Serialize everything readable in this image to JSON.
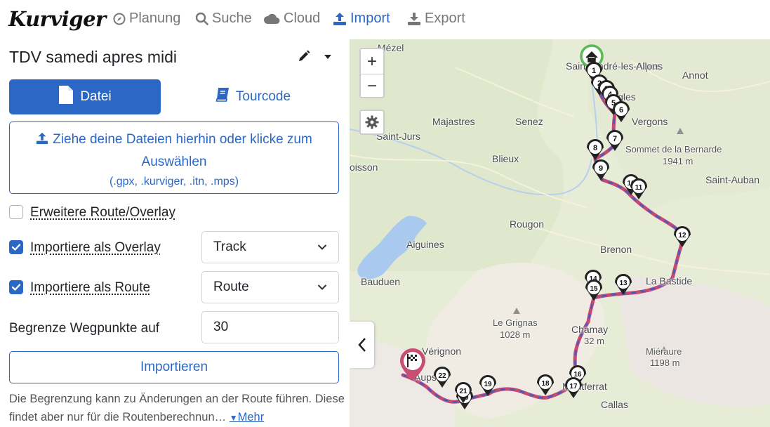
{
  "brand": {
    "logo_text": "Kurviger"
  },
  "nav": {
    "items": [
      {
        "label": "Planung",
        "icon": "compass-icon"
      },
      {
        "label": "Suche",
        "icon": "search-icon"
      },
      {
        "label": "Cloud",
        "icon": "cloud-icon"
      },
      {
        "label": "Import",
        "icon": "upload-icon",
        "active": true
      },
      {
        "label": "Export",
        "icon": "download-icon"
      }
    ]
  },
  "sidebar": {
    "route_title": "TDV samedi apres midi",
    "tabs": {
      "file_label": "Datei",
      "tourcode_label": "Tourcode"
    },
    "dropzone": {
      "main_text": "Ziehe deine Dateien hierhin oder klicke zum Auswählen",
      "formats": "(.gpx, .kurviger, .itn, .mps)"
    },
    "options": {
      "extended_route_label": "Erweitere Route/Overlay",
      "extended_route_checked": false,
      "import_overlay_label": "Importiere als Overlay",
      "import_overlay_checked": true,
      "overlay_select_value": "Track",
      "import_route_label": "Importiere als Route",
      "import_route_checked": true,
      "route_select_value": "Route",
      "limit_label": "Begrenze Wegpunkte auf",
      "limit_value": "30"
    },
    "import_button_label": "Importieren",
    "note_text": "Die Begrenzung kann zu Änderungen an der Route führen. Diese findet aber nur für die Routenberechnun…",
    "more_label": "Mehr"
  },
  "map": {
    "zoom_in_label": "+",
    "zoom_out_label": "−",
    "places": [
      {
        "name": "Mézel"
      },
      {
        "name": "Saint-André-les-Alpes"
      },
      {
        "name": "Allons"
      },
      {
        "name": "Annot"
      },
      {
        "name": "Angles"
      },
      {
        "name": "Majastres"
      },
      {
        "name": "Senez"
      },
      {
        "name": "Vergons"
      },
      {
        "name": "Saint-Jurs"
      },
      {
        "name": "Sommet de la Bernarde"
      },
      {
        "name": "1941 m"
      },
      {
        "name": "oisson"
      },
      {
        "name": "Blieux"
      },
      {
        "name": "Saint-Auban"
      },
      {
        "name": "Rougon"
      },
      {
        "name": "Aiguines"
      },
      {
        "name": "Brenon"
      },
      {
        "name": "Bauduen"
      },
      {
        "name": "La Bastide"
      },
      {
        "name": "Le Grignas"
      },
      {
        "name": "1028 m"
      },
      {
        "name": "Chamay"
      },
      {
        "name": "32 m"
      },
      {
        "name": "Miéraure"
      },
      {
        "name": "1198 m"
      },
      {
        "name": "Vérignon"
      },
      {
        "name": "Aups"
      },
      {
        "name": "Montferrat"
      },
      {
        "name": "Callas"
      }
    ],
    "waypoints": [
      "1",
      "2",
      "3",
      "4",
      "5",
      "6",
      "7",
      "8",
      "9",
      "10",
      "11",
      "12",
      "13",
      "14",
      "15",
      "16",
      "17",
      "18",
      "19",
      "20",
      "21",
      "22"
    ],
    "colors": {
      "route": "#c44a74",
      "track": "#3f5dc9",
      "accent": "#2b67c5",
      "start": "#5cb85c",
      "end": "#c84f73"
    }
  }
}
